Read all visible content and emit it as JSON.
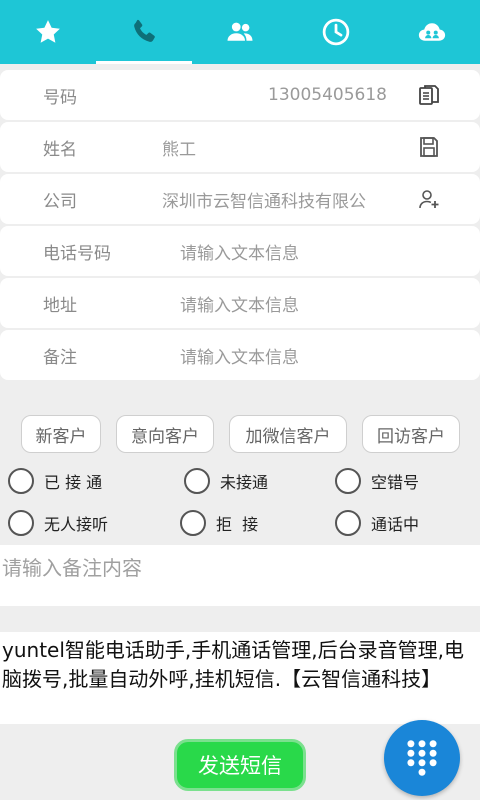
{
  "colors": {
    "accent": "#1ec6d6",
    "send_button": "#29d94a",
    "fab": "#1a86d8"
  },
  "tabs": [
    {
      "icon": "star-icon",
      "active": false
    },
    {
      "icon": "phone-icon",
      "active": true
    },
    {
      "icon": "contacts-icon",
      "active": false
    },
    {
      "icon": "clock-icon",
      "active": false
    },
    {
      "icon": "cloud-group-icon",
      "active": false
    }
  ],
  "form": {
    "number": {
      "label": "号码",
      "value": "13005405618",
      "icon": "copy-icon"
    },
    "name": {
      "label": "姓名",
      "value": "熊工",
      "icon": "save-icon"
    },
    "company": {
      "label": "公司",
      "value": "深圳市云智信通科技有限公",
      "icon": "add-contact-icon"
    },
    "phone": {
      "label": "电话号码",
      "placeholder": "请输入文本信息"
    },
    "address": {
      "label": "地址",
      "placeholder": "请输入文本信息"
    },
    "remark": {
      "label": "备注",
      "placeholder": "请输入文本信息"
    }
  },
  "tags": [
    "新客户",
    "意向客户",
    "加微信客户",
    "回访客户"
  ],
  "statuses": [
    "已 接 通",
    "未接通",
    "空错号",
    "无人接听",
    "拒  接",
    "通话中"
  ],
  "note": {
    "placeholder": "请输入备注内容"
  },
  "sms": {
    "text": "yuntel智能电话助手,手机通话管理,后台录音管理,电脑拨号,批量自动外呼,挂机短信.【云智信通科技】"
  },
  "send_button": {
    "label": "发送短信"
  },
  "fab": {
    "icon": "dialpad-icon"
  }
}
